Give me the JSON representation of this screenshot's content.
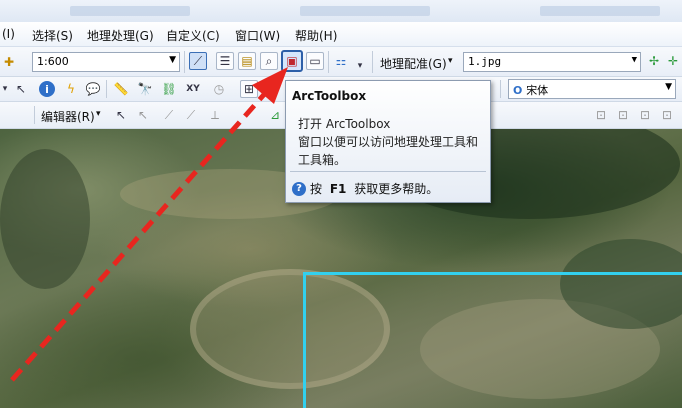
{
  "menubar": {
    "items": [
      "(I)",
      "选择(S)",
      "地理处理(G)",
      "自定义(C)",
      "窗口(W)",
      "帮助(H)"
    ]
  },
  "toolbar1": {
    "scale": "1:600",
    "georef_label": "地理配准(G)",
    "layer": "1.jpg"
  },
  "toolbar2": {
    "font": "宋体"
  },
  "toolbar3": {
    "editor_label": "编辑器(R)"
  },
  "tooltip": {
    "title": "ArcToolbox",
    "description": "打开 ArcToolbox\n窗口以便可以访问地理处理工具和工具箱。",
    "help_prefix": "按 ",
    "help_key": "F1",
    "help_suffix": " 获取更多帮助。"
  },
  "colors": {
    "arrow": "#e8261f",
    "boundary": "#32d0ef"
  }
}
